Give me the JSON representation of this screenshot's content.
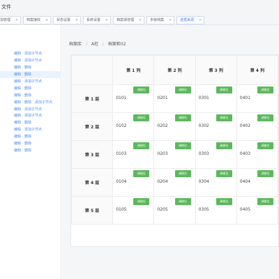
{
  "window": {
    "title": "文件"
  },
  "tabs": [
    {
      "label": "加管理"
    },
    {
      "label": "档案接收"
    },
    {
      "label": "状态设置"
    },
    {
      "label": "系统设置"
    },
    {
      "label": "档案袋管理"
    },
    {
      "label": "未装档案"
    },
    {
      "label": "选框来源"
    }
  ],
  "left_rows": [
    {
      "links": [
        "编辑",
        "添加子节点"
      ]
    },
    {
      "links": [
        "编辑",
        "添加子节点"
      ]
    },
    {
      "links": [
        "编辑",
        "删除"
      ]
    },
    {
      "links": [
        "编辑",
        "删除"
      ]
    },
    {
      "links": [
        "编辑",
        "添加子节点"
      ]
    },
    {
      "links": [
        "编辑",
        "删除"
      ]
    },
    {
      "links": [
        "编辑",
        "删除"
      ]
    },
    {
      "links": [
        "编辑",
        "删除",
        "添加子节点"
      ]
    },
    {
      "links": [
        "编辑",
        "添加子节点"
      ]
    },
    {
      "links": [
        "编辑",
        "添加子节点"
      ]
    },
    {
      "links": [
        "编辑",
        "删除"
      ]
    },
    {
      "links": [
        "编辑",
        "添加子节点"
      ]
    },
    {
      "links": [
        "编辑",
        "删除"
      ]
    },
    {
      "links": [
        "编辑",
        "删除"
      ]
    },
    {
      "links": [
        "编辑",
        "删除"
      ]
    }
  ],
  "breadcrumb": [
    "档案库",
    "A柱",
    "档案柜02"
  ],
  "grid": {
    "columns": [
      "第 1 列",
      "第 2 列",
      "第 3 列",
      "第 4 列"
    ],
    "rows": [
      {
        "label": "第 1 层",
        "cells": [
          "0101",
          "0201",
          "0301",
          "0401"
        ]
      },
      {
        "label": "第 2 层",
        "cells": [
          "0102",
          "0202",
          "0302",
          "0402"
        ]
      },
      {
        "label": "第 3 层",
        "cells": [
          "0103",
          "0203",
          "0303",
          "0403"
        ]
      },
      {
        "label": "第 4 层",
        "cells": [
          "0104",
          "0204",
          "0304",
          "0404"
        ]
      },
      {
        "label": "第 5 层",
        "cells": [
          "0105",
          "0205",
          "0305",
          "0405"
        ]
      }
    ],
    "button_label": "调拨位"
  },
  "colors": {
    "accent": "#4e8ef7",
    "button_green": "#5cb85c",
    "selected_row": "#eaf1ff"
  }
}
